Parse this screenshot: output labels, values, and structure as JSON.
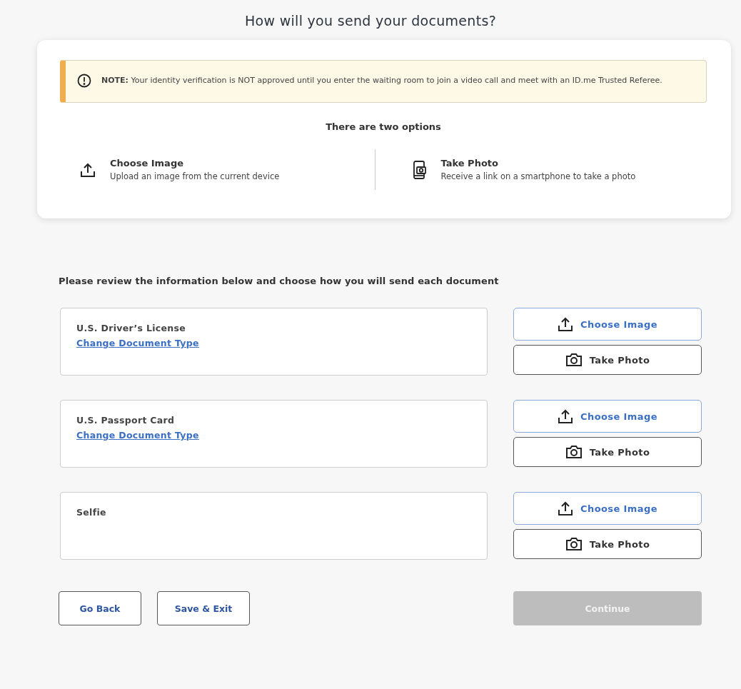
{
  "heading": "How will you send your documents?",
  "note": {
    "text": "**NOTE:** Your identity verification is NOT approved until you enter the waiting room to join a video call and meet with an ID.me Trusted Referee."
  },
  "options_title": "There are two options",
  "options": [
    {
      "kind": "upload",
      "title": "Choose Image",
      "description": "Upload an image from the current device"
    },
    {
      "kind": "phone",
      "title": "Take Photo",
      "description": "Receive a link on a smartphone to take a photo"
    }
  ],
  "instructions": "Please review the information below and choose how you will send each document",
  "documents": [
    {
      "name": "U.S. Driver’s License",
      "link": "Change Document Type",
      "buttons": [
        {
          "kind": "upload",
          "label": "Choose Image"
        },
        {
          "kind": "camera",
          "label": "Take Photo"
        }
      ]
    },
    {
      "name": "U.S. Passport Card",
      "link": "Change Document Type",
      "buttons": [
        {
          "kind": "upload",
          "label": "Choose Image"
        },
        {
          "kind": "camera",
          "label": "Take Photo"
        }
      ]
    },
    {
      "name": "Selfie",
      "buttons": [
        {
          "kind": "upload",
          "label": "Choose Image"
        },
        {
          "kind": "camera",
          "label": "Take Photo"
        }
      ]
    }
  ],
  "footer": {
    "back": "Go Back",
    "save": "Save & Exit",
    "continue": {
      "label": "Continue",
      "disabled": true
    }
  }
}
